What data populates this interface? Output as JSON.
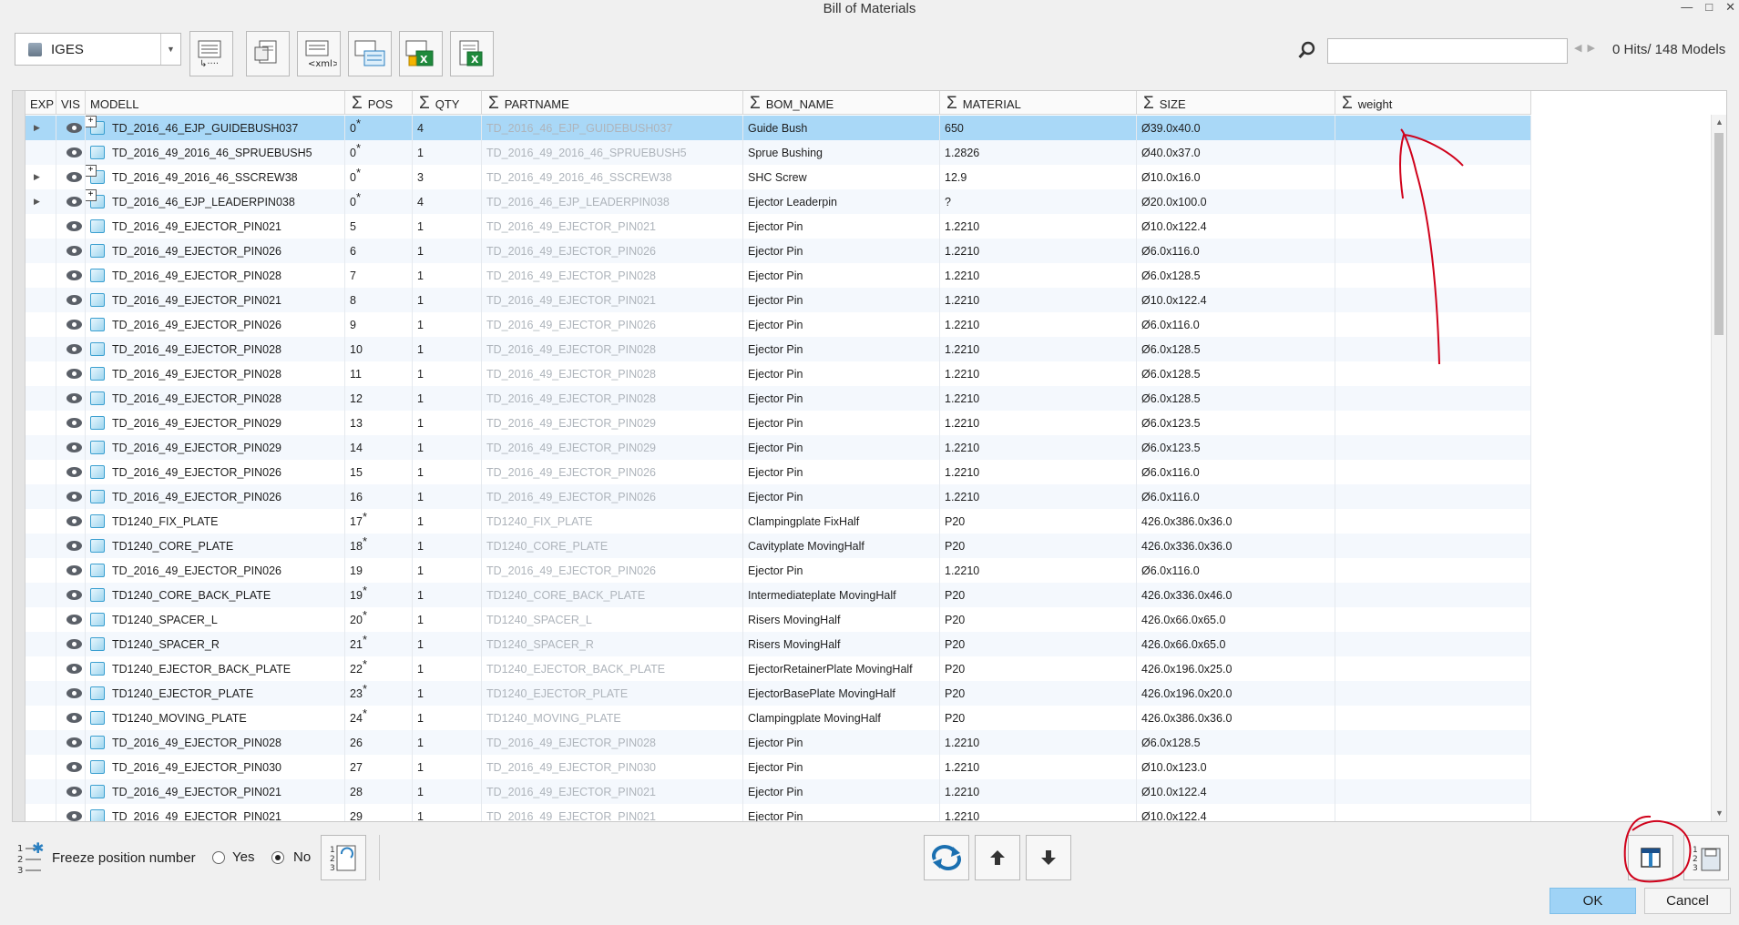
{
  "window": {
    "title": "Bill of Materials"
  },
  "toolbar": {
    "format_value": "IGES",
    "search_placeholder": "",
    "hits_text": "0 Hits/ 148 Models"
  },
  "columns": [
    "EXP",
    "VIS",
    "MODELL",
    "POS",
    "QTY",
    "PARTNAME",
    "BOM_NAME",
    "MATERIAL",
    "SIZE",
    "weight"
  ],
  "rows": [
    {
      "expand": true,
      "asm": true,
      "model": "TD_2016_46_EJP_GUIDEBUSH037",
      "pos": "0",
      "star": true,
      "qty": "4",
      "partname": "TD_2016_46_EJP_GUIDEBUSH037",
      "bom": "Guide Bush",
      "material": "650",
      "size": "Ø39.0x40.0",
      "weight": ""
    },
    {
      "expand": false,
      "asm": false,
      "model": "TD_2016_49_2016_46_SPRUEBUSH5",
      "pos": "0",
      "star": true,
      "qty": "1",
      "partname": "TD_2016_49_2016_46_SPRUEBUSH5",
      "bom": "Sprue Bushing",
      "material": "1.2826",
      "size": "Ø40.0x37.0",
      "weight": ""
    },
    {
      "expand": true,
      "asm": true,
      "model": "TD_2016_49_2016_46_SSCREW38",
      "pos": "0",
      "star": true,
      "qty": "3",
      "partname": "TD_2016_49_2016_46_SSCREW38",
      "bom": "SHC Screw",
      "material": "12.9",
      "size": "Ø10.0x16.0",
      "weight": ""
    },
    {
      "expand": true,
      "asm": true,
      "model": "TD_2016_46_EJP_LEADERPIN038",
      "pos": "0",
      "star": true,
      "qty": "4",
      "partname": "TD_2016_46_EJP_LEADERPIN038",
      "bom": "Ejector Leaderpin",
      "material": "?",
      "size": "Ø20.0x100.0",
      "weight": ""
    },
    {
      "expand": false,
      "asm": false,
      "model": "TD_2016_49_EJECTOR_PIN021",
      "pos": "5",
      "star": false,
      "qty": "1",
      "partname": "TD_2016_49_EJECTOR_PIN021",
      "bom": "Ejector Pin",
      "material": "1.2210",
      "size": "Ø10.0x122.4",
      "weight": ""
    },
    {
      "expand": false,
      "asm": false,
      "model": "TD_2016_49_EJECTOR_PIN026",
      "pos": "6",
      "star": false,
      "qty": "1",
      "partname": "TD_2016_49_EJECTOR_PIN026",
      "bom": "Ejector Pin",
      "material": "1.2210",
      "size": "Ø6.0x116.0",
      "weight": ""
    },
    {
      "expand": false,
      "asm": false,
      "model": "TD_2016_49_EJECTOR_PIN028",
      "pos": "7",
      "star": false,
      "qty": "1",
      "partname": "TD_2016_49_EJECTOR_PIN028",
      "bom": "Ejector Pin",
      "material": "1.2210",
      "size": "Ø6.0x128.5",
      "weight": ""
    },
    {
      "expand": false,
      "asm": false,
      "model": "TD_2016_49_EJECTOR_PIN021",
      "pos": "8",
      "star": false,
      "qty": "1",
      "partname": "TD_2016_49_EJECTOR_PIN021",
      "bom": "Ejector Pin",
      "material": "1.2210",
      "size": "Ø10.0x122.4",
      "weight": ""
    },
    {
      "expand": false,
      "asm": false,
      "model": "TD_2016_49_EJECTOR_PIN026",
      "pos": "9",
      "star": false,
      "qty": "1",
      "partname": "TD_2016_49_EJECTOR_PIN026",
      "bom": "Ejector Pin",
      "material": "1.2210",
      "size": "Ø6.0x116.0",
      "weight": ""
    },
    {
      "expand": false,
      "asm": false,
      "model": "TD_2016_49_EJECTOR_PIN028",
      "pos": "10",
      "star": false,
      "qty": "1",
      "partname": "TD_2016_49_EJECTOR_PIN028",
      "bom": "Ejector Pin",
      "material": "1.2210",
      "size": "Ø6.0x128.5",
      "weight": ""
    },
    {
      "expand": false,
      "asm": false,
      "model": "TD_2016_49_EJECTOR_PIN028",
      "pos": "11",
      "star": false,
      "qty": "1",
      "partname": "TD_2016_49_EJECTOR_PIN028",
      "bom": "Ejector Pin",
      "material": "1.2210",
      "size": "Ø6.0x128.5",
      "weight": ""
    },
    {
      "expand": false,
      "asm": false,
      "model": "TD_2016_49_EJECTOR_PIN028",
      "pos": "12",
      "star": false,
      "qty": "1",
      "partname": "TD_2016_49_EJECTOR_PIN028",
      "bom": "Ejector Pin",
      "material": "1.2210",
      "size": "Ø6.0x128.5",
      "weight": ""
    },
    {
      "expand": false,
      "asm": false,
      "model": "TD_2016_49_EJECTOR_PIN029",
      "pos": "13",
      "star": false,
      "qty": "1",
      "partname": "TD_2016_49_EJECTOR_PIN029",
      "bom": "Ejector Pin",
      "material": "1.2210",
      "size": "Ø6.0x123.5",
      "weight": ""
    },
    {
      "expand": false,
      "asm": false,
      "model": "TD_2016_49_EJECTOR_PIN029",
      "pos": "14",
      "star": false,
      "qty": "1",
      "partname": "TD_2016_49_EJECTOR_PIN029",
      "bom": "Ejector Pin",
      "material": "1.2210",
      "size": "Ø6.0x123.5",
      "weight": ""
    },
    {
      "expand": false,
      "asm": false,
      "model": "TD_2016_49_EJECTOR_PIN026",
      "pos": "15",
      "star": false,
      "qty": "1",
      "partname": "TD_2016_49_EJECTOR_PIN026",
      "bom": "Ejector Pin",
      "material": "1.2210",
      "size": "Ø6.0x116.0",
      "weight": ""
    },
    {
      "expand": false,
      "asm": false,
      "model": "TD_2016_49_EJECTOR_PIN026",
      "pos": "16",
      "star": false,
      "qty": "1",
      "partname": "TD_2016_49_EJECTOR_PIN026",
      "bom": "Ejector Pin",
      "material": "1.2210",
      "size": "Ø6.0x116.0",
      "weight": ""
    },
    {
      "expand": false,
      "asm": false,
      "model": "TD1240_FIX_PLATE",
      "pos": "17",
      "star": true,
      "qty": "1",
      "partname": "TD1240_FIX_PLATE",
      "bom": "Clampingplate FixHalf",
      "material": "P20",
      "size": "426.0x386.0x36.0",
      "weight": ""
    },
    {
      "expand": false,
      "asm": false,
      "model": "TD1240_CORE_PLATE",
      "pos": "18",
      "star": true,
      "qty": "1",
      "partname": "TD1240_CORE_PLATE",
      "bom": "Cavityplate MovingHalf",
      "material": "P20",
      "size": "426.0x336.0x36.0",
      "weight": ""
    },
    {
      "expand": false,
      "asm": false,
      "model": "TD_2016_49_EJECTOR_PIN026",
      "pos": "19",
      "star": false,
      "qty": "1",
      "partname": "TD_2016_49_EJECTOR_PIN026",
      "bom": "Ejector Pin",
      "material": "1.2210",
      "size": "Ø6.0x116.0",
      "weight": ""
    },
    {
      "expand": false,
      "asm": false,
      "model": "TD1240_CORE_BACK_PLATE",
      "pos": "19",
      "star": true,
      "qty": "1",
      "partname": "TD1240_CORE_BACK_PLATE",
      "bom": "Intermediateplate MovingHalf",
      "material": "P20",
      "size": "426.0x336.0x46.0",
      "weight": ""
    },
    {
      "expand": false,
      "asm": false,
      "model": "TD1240_SPACER_L",
      "pos": "20",
      "star": true,
      "qty": "1",
      "partname": "TD1240_SPACER_L",
      "bom": "Risers MovingHalf",
      "material": "P20",
      "size": "426.0x66.0x65.0",
      "weight": ""
    },
    {
      "expand": false,
      "asm": false,
      "model": "TD1240_SPACER_R",
      "pos": "21",
      "star": true,
      "qty": "1",
      "partname": "TD1240_SPACER_R",
      "bom": "Risers MovingHalf",
      "material": "P20",
      "size": "426.0x66.0x65.0",
      "weight": ""
    },
    {
      "expand": false,
      "asm": false,
      "model": "TD1240_EJECTOR_BACK_PLATE",
      "pos": "22",
      "star": true,
      "qty": "1",
      "partname": "TD1240_EJECTOR_BACK_PLATE",
      "bom": "EjectorRetainerPlate MovingHalf",
      "material": "P20",
      "size": "426.0x196.0x25.0",
      "weight": ""
    },
    {
      "expand": false,
      "asm": false,
      "model": "TD1240_EJECTOR_PLATE",
      "pos": "23",
      "star": true,
      "qty": "1",
      "partname": "TD1240_EJECTOR_PLATE",
      "bom": "EjectorBasePlate MovingHalf",
      "material": "P20",
      "size": "426.0x196.0x20.0",
      "weight": ""
    },
    {
      "expand": false,
      "asm": false,
      "model": "TD1240_MOVING_PLATE",
      "pos": "24",
      "star": true,
      "qty": "1",
      "partname": "TD1240_MOVING_PLATE",
      "bom": "Clampingplate MovingHalf",
      "material": "P20",
      "size": "426.0x386.0x36.0",
      "weight": ""
    },
    {
      "expand": false,
      "asm": false,
      "model": "TD_2016_49_EJECTOR_PIN028",
      "pos": "26",
      "star": false,
      "qty": "1",
      "partname": "TD_2016_49_EJECTOR_PIN028",
      "bom": "Ejector Pin",
      "material": "1.2210",
      "size": "Ø6.0x128.5",
      "weight": ""
    },
    {
      "expand": false,
      "asm": false,
      "model": "TD_2016_49_EJECTOR_PIN030",
      "pos": "27",
      "star": false,
      "qty": "1",
      "partname": "TD_2016_49_EJECTOR_PIN030",
      "bom": "Ejector Pin",
      "material": "1.2210",
      "size": "Ø10.0x123.0",
      "weight": ""
    },
    {
      "expand": false,
      "asm": false,
      "model": "TD_2016_49_EJECTOR_PIN021",
      "pos": "28",
      "star": false,
      "qty": "1",
      "partname": "TD_2016_49_EJECTOR_PIN021",
      "bom": "Ejector Pin",
      "material": "1.2210",
      "size": "Ø10.0x122.4",
      "weight": ""
    },
    {
      "expand": false,
      "asm": false,
      "model": "TD_2016_49_EJECTOR_PIN021",
      "pos": "29",
      "star": false,
      "qty": "1",
      "partname": "TD_2016_49_EJECTOR_PIN021",
      "bom": "Ejector Pin",
      "material": "1.2210",
      "size": "Ø10.0x122.4",
      "weight": ""
    }
  ],
  "bottom": {
    "freeze_label": "Freeze position number",
    "yes_label": "Yes",
    "no_label": "No",
    "ok_label": "OK",
    "cancel_label": "Cancel"
  },
  "colors": {
    "selection": "#a9d8f7",
    "annotation": "#d0021b",
    "ok_button": "#9fd3f6"
  }
}
